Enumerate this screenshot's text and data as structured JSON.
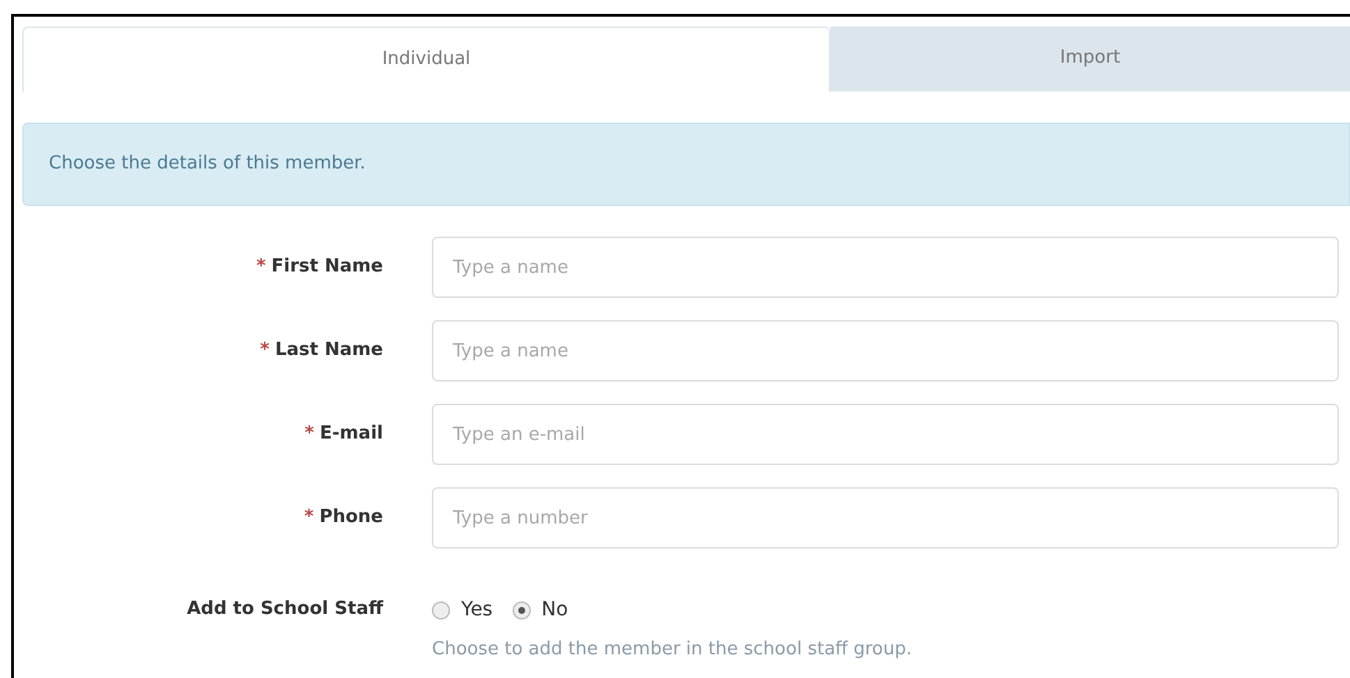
{
  "tabs": [
    {
      "label": "Individual",
      "selected": true
    },
    {
      "label": "Import",
      "selected": false
    }
  ],
  "info_message": "Choose the details of this member.",
  "fields": [
    {
      "required_mark": "*",
      "label": "First Name",
      "placeholder": "Type a name"
    },
    {
      "required_mark": "*",
      "label": "Last Name",
      "placeholder": "Type a name"
    },
    {
      "required_mark": "*",
      "label": "E-mail",
      "placeholder": "Type an e-mail"
    },
    {
      "required_mark": "*",
      "label": "Phone",
      "placeholder": "Type a number"
    }
  ],
  "staff": {
    "label": "Add to School Staff",
    "options": [
      {
        "label": "Yes",
        "selected": false
      },
      {
        "label": "No",
        "selected": true
      }
    ],
    "help": "Choose to add the member in the school staff group."
  }
}
